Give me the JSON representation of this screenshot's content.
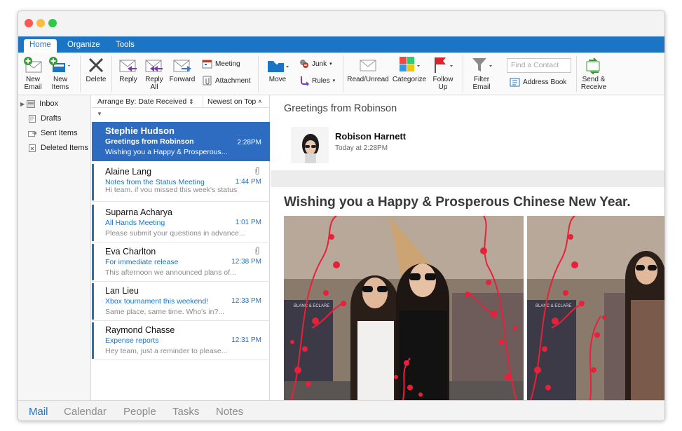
{
  "tabs": [
    {
      "label": "Home",
      "active": true
    },
    {
      "label": "Organize",
      "active": false
    },
    {
      "label": "Tools",
      "active": false
    }
  ],
  "ribbon": {
    "new_email": "New\nEmail",
    "new_items": "New\nItems",
    "delete": "Delete",
    "reply": "Reply",
    "reply_all": "Reply\nAll",
    "forward": "Forward",
    "meeting": "Meeting",
    "attachment": "Attachment",
    "move": "Move",
    "junk": "Junk",
    "rules": "Rules",
    "read_unread": "Read/Unread",
    "categorize": "Categorize",
    "follow_up": "Follow\nUp",
    "filter_email": "Filter\nEmail",
    "find_contact_placeholder": "Find a Contact",
    "address_book": "Address Book",
    "send_receive": "Send &\nReceive"
  },
  "folders": [
    {
      "label": "Inbox",
      "icon": "inbox-icon"
    },
    {
      "label": "Drafts",
      "icon": "drafts-icon"
    },
    {
      "label": "Sent Items",
      "icon": "sent-icon"
    },
    {
      "label": "Deleted Items",
      "icon": "trash-icon"
    }
  ],
  "list_header": {
    "arrange_by": "Arrange By: Date Received",
    "sort_order": "Newest on Top"
  },
  "messages": [
    {
      "sender": "Stephie Hudson",
      "subject": "Greetings from Robinson",
      "time": "2:28PM",
      "preview": "Wishing you a Happy & Prosperous...",
      "selected": true,
      "attachment": false
    },
    {
      "sender": "Alaine Lang",
      "subject": "Notes from the Status Meeting",
      "time": "1:44 PM",
      "preview": "Hi team, if you missed this week's status",
      "selected": false,
      "attachment": true
    },
    {
      "sender": "Suparna Acharya",
      "subject": "All Hands Meeting",
      "time": "1:01 PM",
      "preview": "Please submit your questions in advance...",
      "selected": false,
      "attachment": false
    },
    {
      "sender": "Eva Charlton",
      "subject": "For immediate release",
      "time": "12:38 PM",
      "preview": "This afternoon we announced plans of...",
      "selected": false,
      "attachment": true
    },
    {
      "sender": "Lan Lieu",
      "subject": "Xbox tournament this weekend!",
      "time": "12:33 PM",
      "preview": "Same place, same time. Who's in?...",
      "selected": false,
      "attachment": false
    },
    {
      "sender": "Raymond Chasse",
      "subject": "Expense reports",
      "time": "12:31 PM",
      "preview": "Hey team, just a reminder to please...",
      "selected": false,
      "attachment": false
    }
  ],
  "reading": {
    "subject": "Greetings from Robinson",
    "sender": "Robison Harnett",
    "date": "Today at 2:28PM",
    "headline": "Wishing you a Happy & Prosperous Chinese New Year."
  },
  "bottom_nav": [
    {
      "label": "Mail",
      "active": true
    },
    {
      "label": "Calendar",
      "active": false
    },
    {
      "label": "People",
      "active": false
    },
    {
      "label": "Tasks",
      "active": false
    },
    {
      "label": "Notes",
      "active": false
    }
  ],
  "colors": {
    "accent": "#1b74c4",
    "selected_row": "#2d6cc0",
    "blossom": "#e8213a"
  }
}
